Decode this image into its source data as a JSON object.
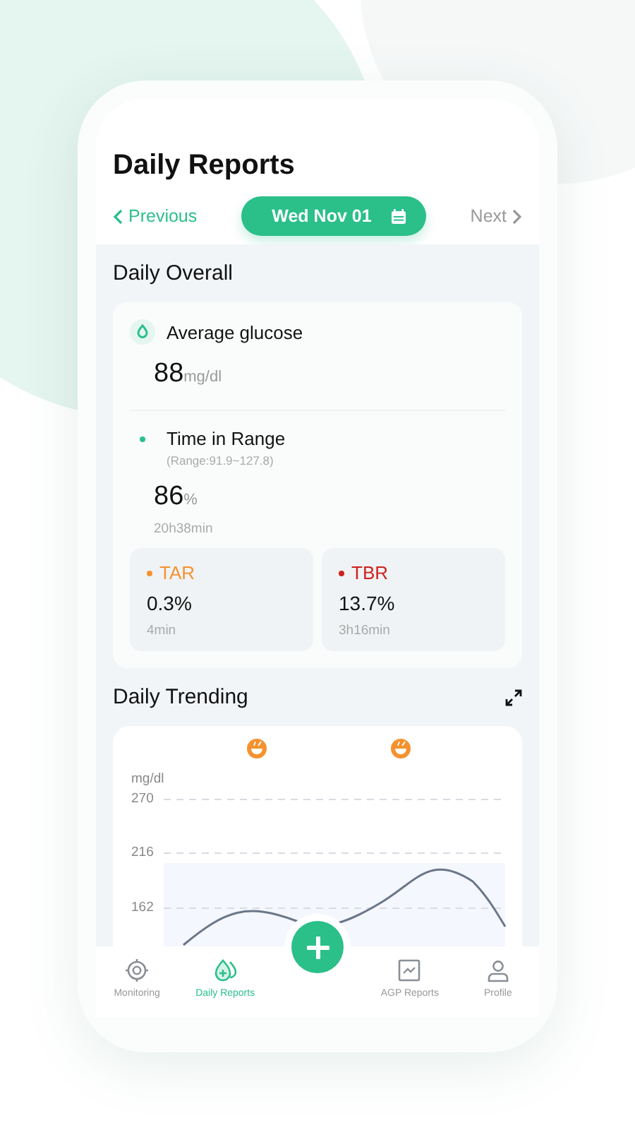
{
  "header": {
    "title": "Daily Reports",
    "previous": "Previous",
    "date": "Wed Nov 01",
    "next": "Next"
  },
  "overall": {
    "title": "Daily Overall",
    "average": {
      "label": "Average glucose",
      "value": "88",
      "unit": "mg/dl"
    },
    "tir": {
      "label": "Time in Range",
      "range": "(Range:91.9~127.8)",
      "value": "86",
      "unit": "%",
      "duration": "20h38min",
      "color": "#2bbf8a"
    },
    "tiles": [
      {
        "label": "TAR",
        "value": "0.3%",
        "duration": "4min",
        "color": "#f5922f"
      },
      {
        "label": "TBR",
        "value": "13.7%",
        "duration": "3h16min",
        "color": "#d0211c"
      }
    ]
  },
  "trending": {
    "title": "Daily Trending",
    "unit": "mg/dl",
    "y_ticks": [
      "270",
      "216",
      "162"
    ]
  },
  "tabs": [
    {
      "label": "Monitoring",
      "kind": "target",
      "selected": false
    },
    {
      "label": "Daily Reports",
      "kind": "drops",
      "selected": true
    },
    {
      "label": "AGP Reports",
      "kind": "chart",
      "selected": false
    },
    {
      "label": "Profile",
      "kind": "person",
      "selected": false
    }
  ]
}
